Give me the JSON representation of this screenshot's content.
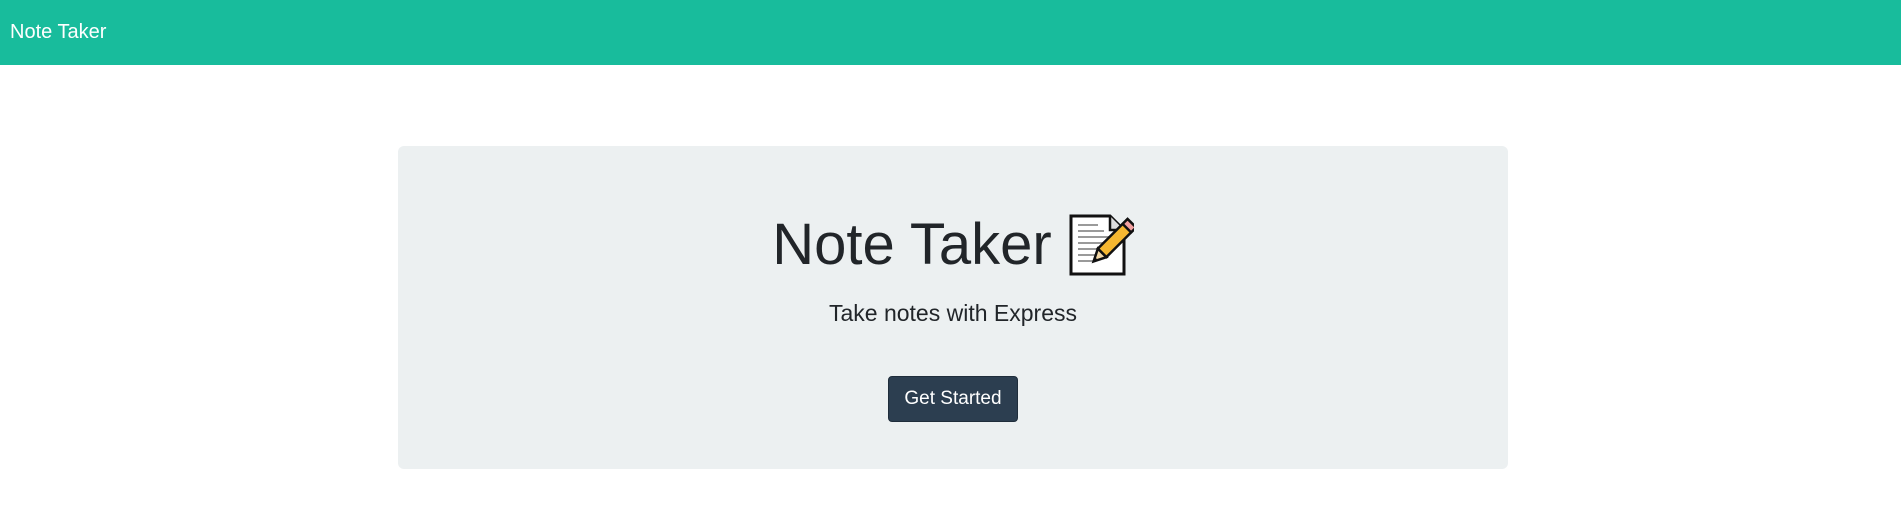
{
  "navbar": {
    "brand": "Note Taker"
  },
  "hero": {
    "title": "Note Taker",
    "title_icon": "memo-icon",
    "subtitle": "Take notes with Express",
    "cta_label": "Get Started"
  },
  "colors": {
    "navbar_bg": "#18bc9c",
    "hero_bg": "#ecf0f1",
    "button_bg": "#2c3e50",
    "text": "#212529"
  }
}
